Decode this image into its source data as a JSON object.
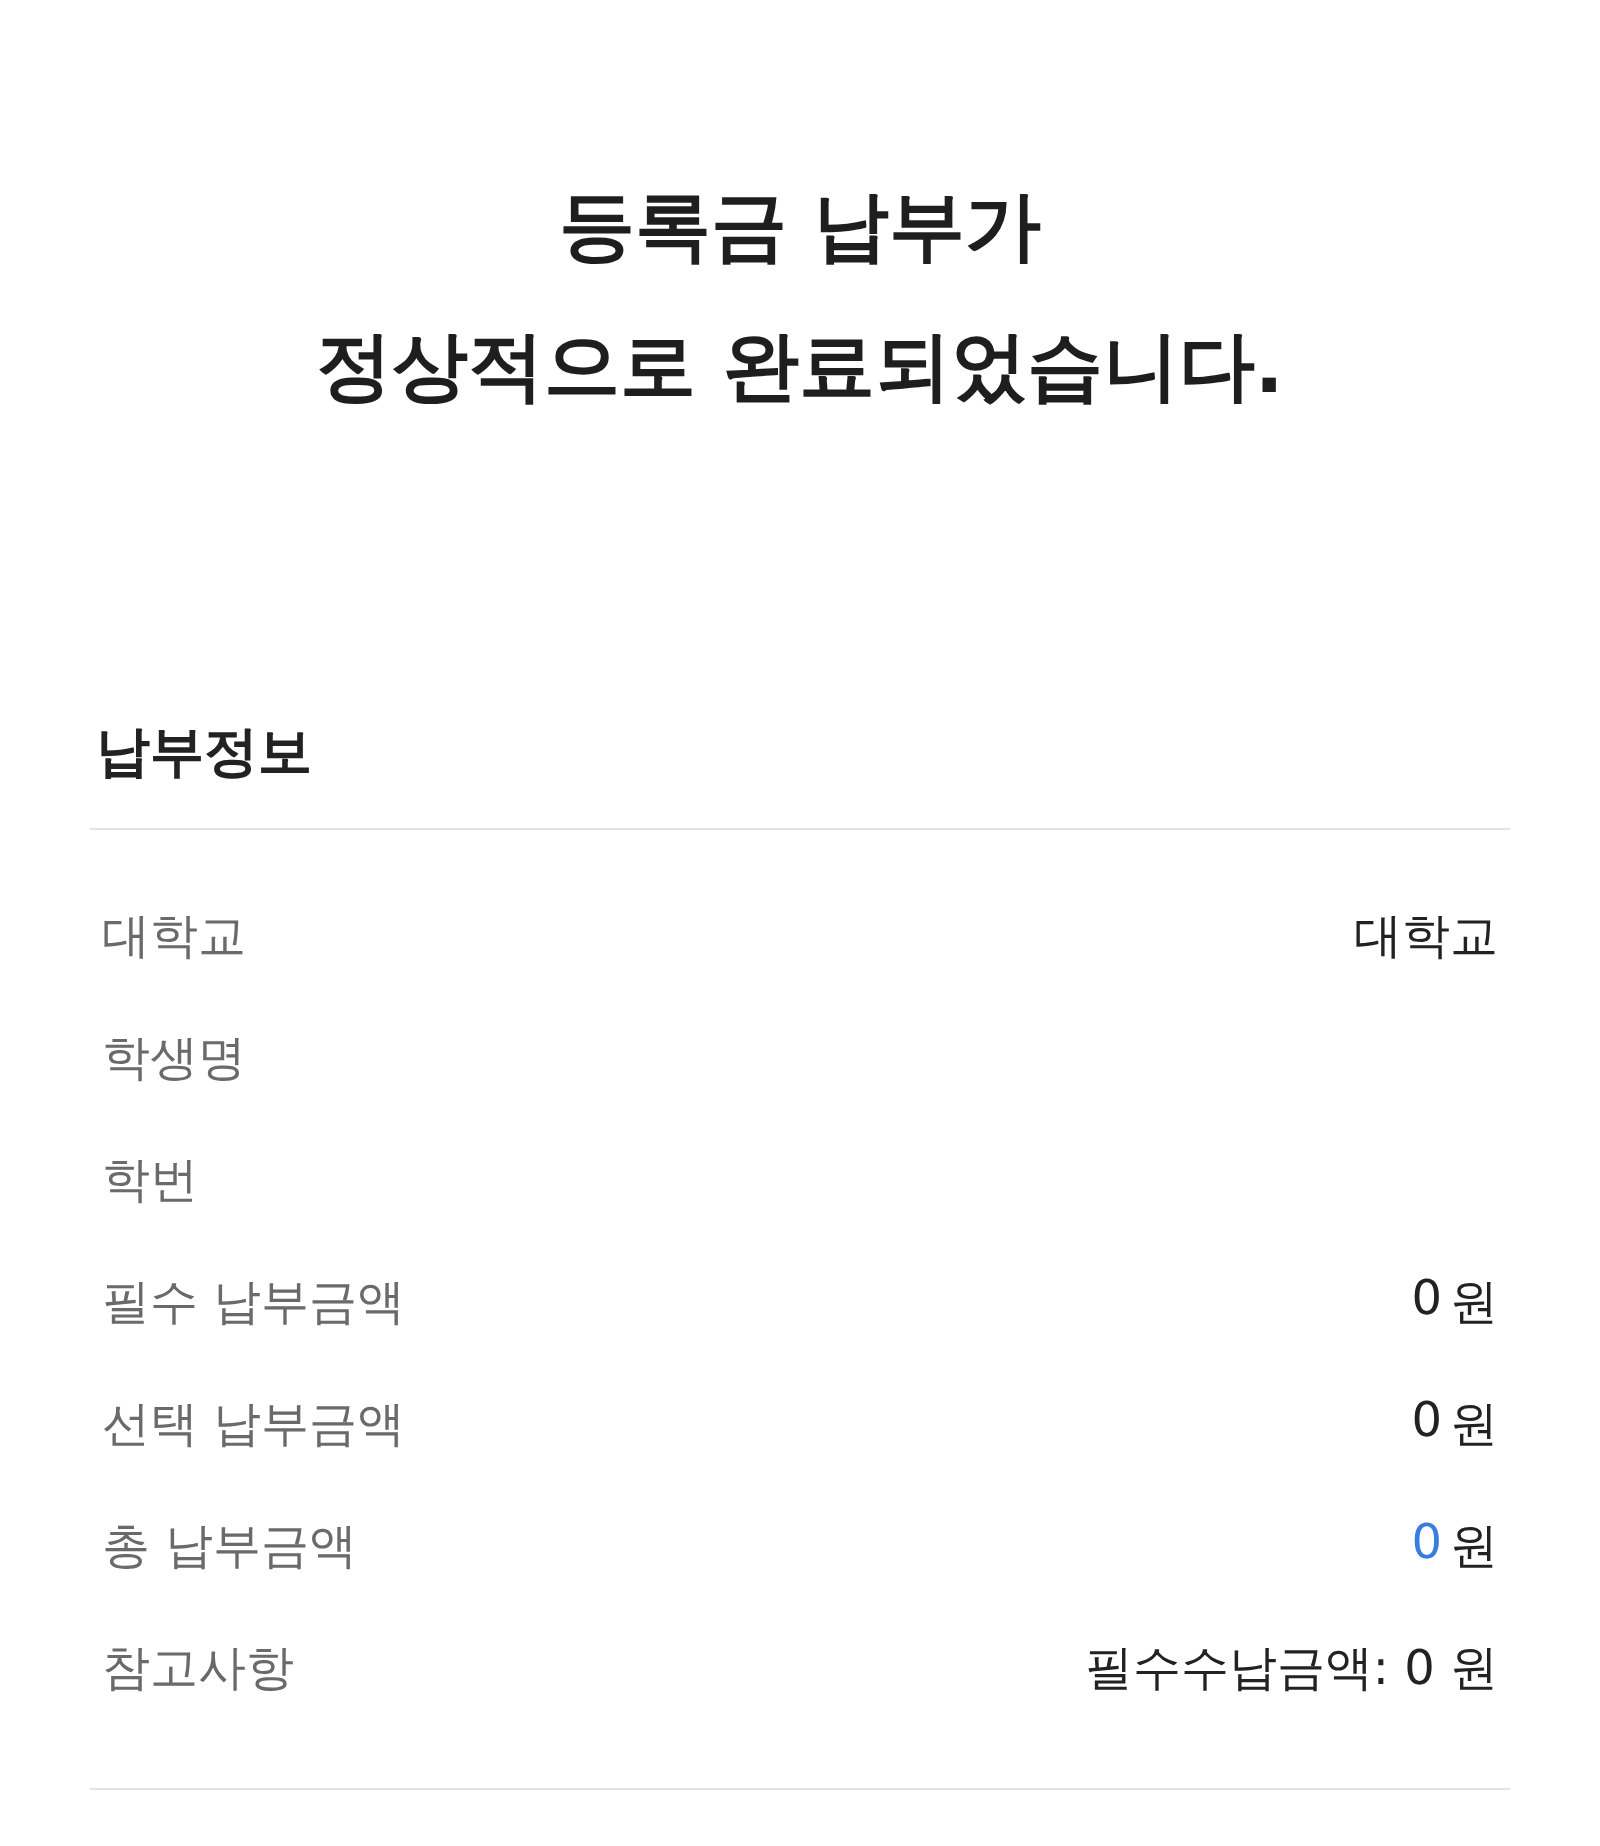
{
  "headline": [
    "등록금 납부가",
    "정상적으로 완료되었습니다."
  ],
  "section": {
    "title": "납부정보",
    "rows": [
      {
        "kind": "text",
        "label": "대학교",
        "value": "대학교"
      },
      {
        "kind": "text",
        "label": "학생명"
      },
      {
        "kind": "text",
        "label": "학번"
      },
      {
        "kind": "amount",
        "label": "필수 납부금액",
        "amount": "0",
        "unit": "원",
        "highlighted": false
      },
      {
        "kind": "amount",
        "label": "선택 납부금액",
        "amount": "0",
        "unit": "원",
        "highlighted": false
      },
      {
        "kind": "amount",
        "label": "총 납부금액",
        "amount": "0",
        "unit": "원",
        "highlighted": true
      },
      {
        "kind": "text",
        "label": "참고사항",
        "value": "필수수납금액: 0 원"
      }
    ]
  }
}
